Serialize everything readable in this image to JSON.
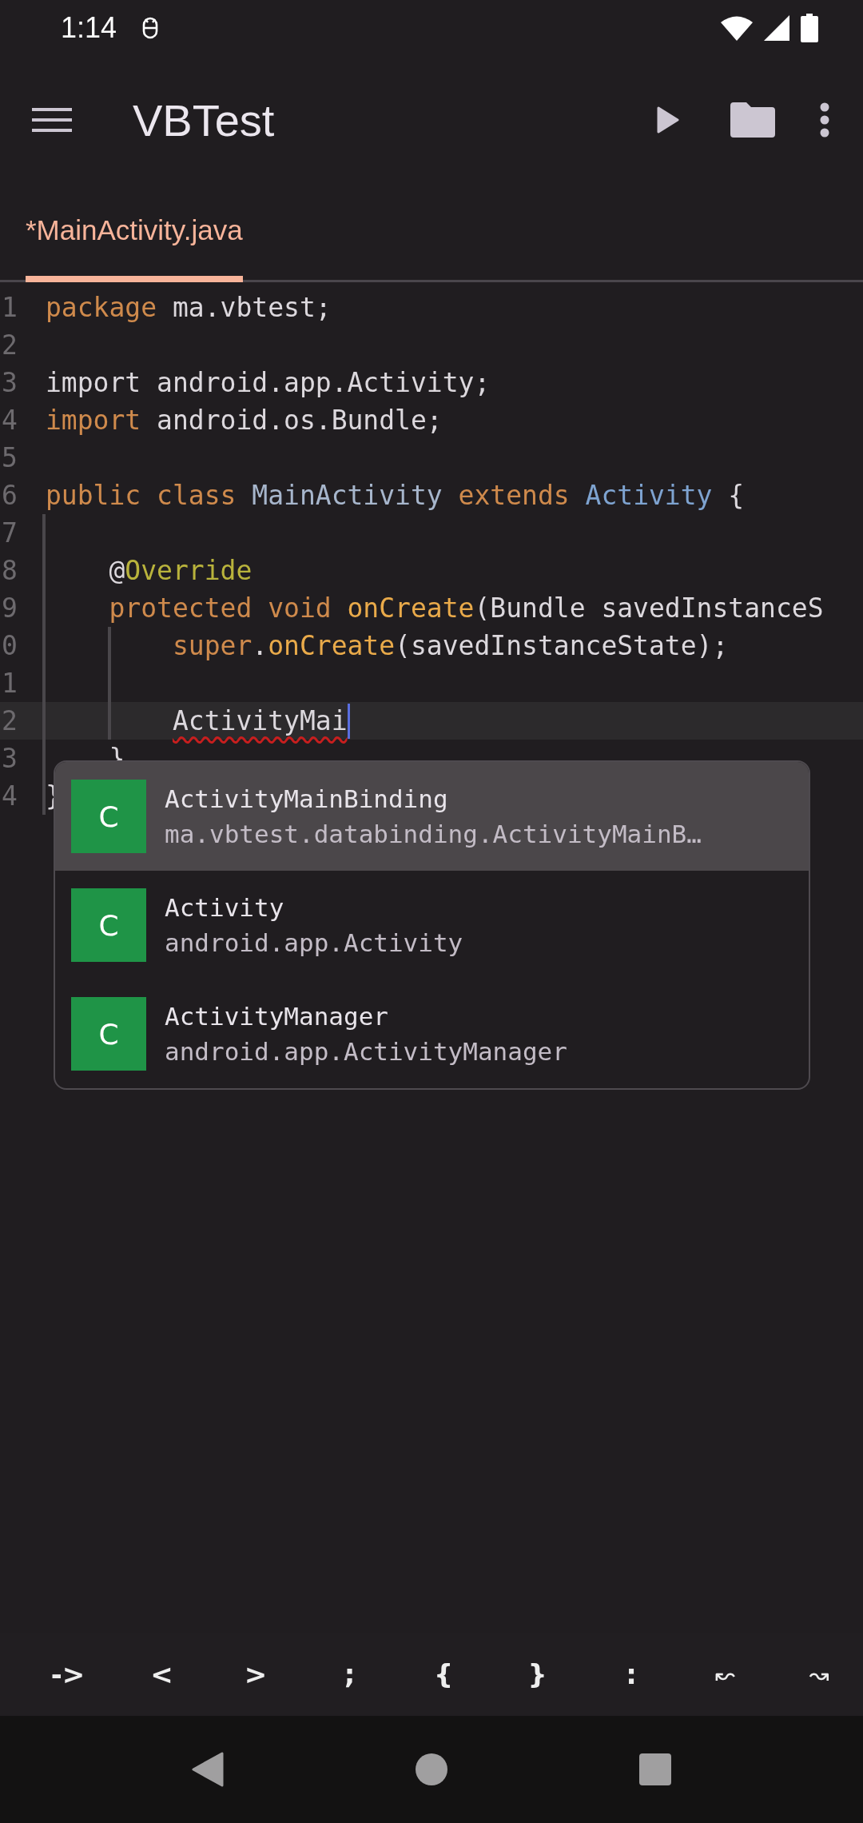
{
  "status_bar": {
    "time": "1:14"
  },
  "toolbar": {
    "title": "VBTest"
  },
  "tabs": [
    {
      "label": "*MainActivity.java",
      "selected": true
    }
  ],
  "editor": {
    "lines": [
      {
        "number": "1",
        "current": false,
        "tokens": [
          {
            "text": "package",
            "kind": "keyword"
          },
          {
            "text": " ma.vbtest;",
            "kind": "plain"
          }
        ]
      },
      {
        "number": "2",
        "current": false
      },
      {
        "number": "3",
        "current": false,
        "tokens": [
          {
            "text": "import",
            "kind": "plain"
          },
          {
            "text": " android.app.Activity;",
            "kind": "plain"
          }
        ]
      },
      {
        "number": "4",
        "current": false,
        "tokens": [
          {
            "text": "import",
            "kind": "keyword"
          },
          {
            "text": " android.os.Bundle;",
            "kind": "plain"
          }
        ]
      },
      {
        "number": "5",
        "current": false
      },
      {
        "number": "6",
        "current": false,
        "tokens": [
          {
            "text": "public class",
            "kind": "keyword"
          },
          {
            "text": " MainActivity ",
            "kind": "classname"
          },
          {
            "text": "extends",
            "kind": "keyword"
          },
          {
            "text": " Activity",
            "kind": "type"
          },
          {
            "text": " {",
            "kind": "plain"
          }
        ]
      },
      {
        "number": "7",
        "current": false
      },
      {
        "number": "8",
        "current": false,
        "tokens": [
          {
            "text": "    @",
            "kind": "plain"
          },
          {
            "text": "Override",
            "kind": "annotation"
          }
        ]
      },
      {
        "number": "9",
        "current": false,
        "tokens": [
          {
            "text": "    protected void",
            "kind": "keyword"
          },
          {
            "text": " onCreate",
            "kind": "method"
          },
          {
            "text": "(Bundle savedInstanceS",
            "kind": "plain"
          }
        ]
      },
      {
        "number": "0",
        "current": false,
        "tokens": [
          {
            "text": "        super",
            "kind": "keyword"
          },
          {
            "text": ".",
            "kind": "plain"
          },
          {
            "text": "onCreate",
            "kind": "method"
          },
          {
            "text": "(savedInstanceState);",
            "kind": "plain"
          }
        ]
      },
      {
        "number": "1",
        "current": false
      },
      {
        "number": "2",
        "current": true,
        "tokens": [
          {
            "text": "        ActivityMai",
            "kind": "error"
          }
        ]
      },
      {
        "number": "3",
        "current": false,
        "tokens": [
          {
            "text": "    }",
            "kind": "plain"
          }
        ]
      },
      {
        "number": "4",
        "current": false,
        "tokens": [
          {
            "text": "}",
            "kind": "plain"
          }
        ]
      }
    ]
  },
  "completion": {
    "items": [
      {
        "icon": "C",
        "name": "ActivityMainBinding",
        "detail": "ma.vbtest.databinding.ActivityMainB…",
        "selected": true
      },
      {
        "icon": "C",
        "name": "Activity",
        "detail": "android.app.Activity",
        "selected": false
      },
      {
        "icon": "C",
        "name": "ActivityManager",
        "detail": "android.app.ActivityManager",
        "selected": false
      }
    ]
  },
  "symbol_bar": {
    "keys": [
      "->",
      "<",
      ">",
      ";",
      "{",
      "}",
      ":",
      "↜",
      "↝"
    ]
  }
}
